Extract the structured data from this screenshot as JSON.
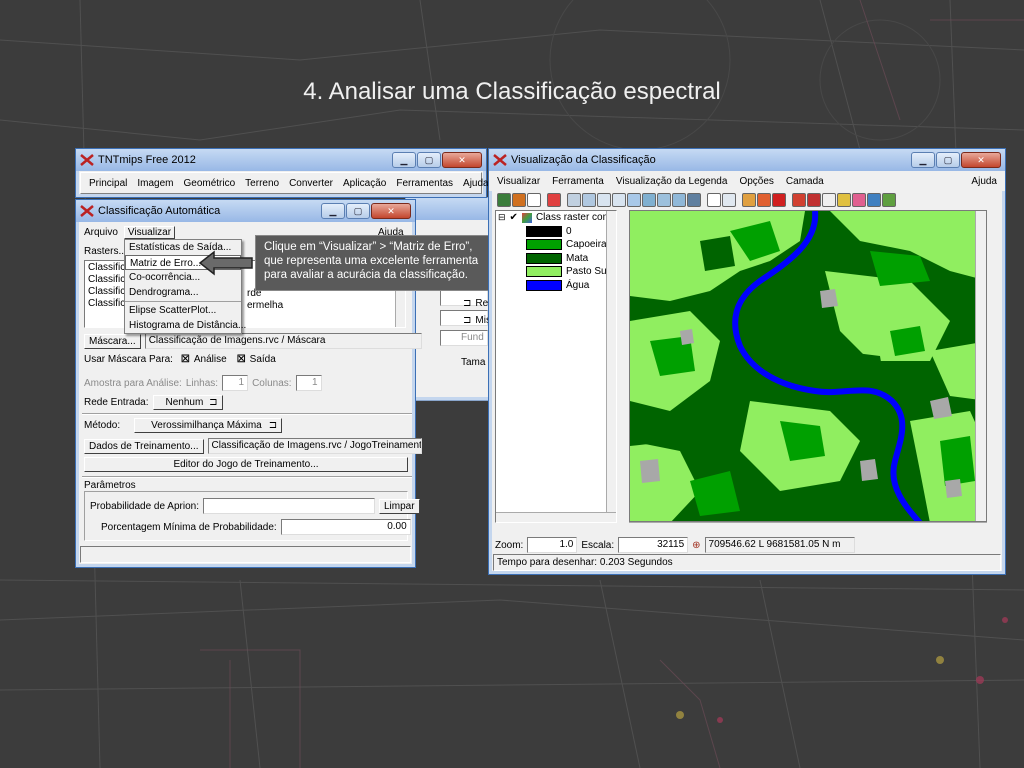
{
  "slide": {
    "title": "4. Analisar uma Classificação espectral"
  },
  "tntmips": {
    "title": "TNTmips Free 2012",
    "menu": [
      "Principal",
      "Imagem",
      "Geométrico",
      "Terreno",
      "Converter",
      "Aplicação",
      "Ferramentas",
      "Ajuda"
    ]
  },
  "classif": {
    "title": "Classificação Automática",
    "menu": [
      "Arquivo",
      "Visualizar"
    ],
    "help": "Ajuda",
    "rasters_label": "Rasters...",
    "raster_items": [
      "Classific",
      "Classific",
      "Classific",
      "Classific"
    ],
    "raster_tails": [
      "rde",
      "ermelha"
    ],
    "mask_button": "Máscara...",
    "mask_value": "Classificação de Imagens.rvc / Máscara",
    "use_mask_label": "Usar Máscara Para:",
    "use_mask_analysis": "Análise",
    "use_mask_output": "Saída",
    "sample_label": "Amostra para Análise:",
    "lines_label": "Linhas:",
    "lines_value": "1",
    "columns_label": "Colunas:",
    "columns_value": "1",
    "network_label": "Rede Entrada:",
    "network_value": "Nenhum",
    "method_label": "Método:",
    "method_value": "Verossimilhança Máxima",
    "training_button": "Dados de Treinamento...",
    "training_value": "Classificação de Imagens.rvc / JogoTreinamento",
    "editor_button": "Editor do Jogo de Treinamento...",
    "params_title": "Parâmetros",
    "prob_label": "Probabilidade de Aprion:",
    "clear_button": "Limpar",
    "min_prob_label": "Porcentagem Mínima de Probabilidade:",
    "min_prob_value": "0.00"
  },
  "visualizar_menu": {
    "items": [
      "Estatísticas de Saída...",
      "Matriz de Erro...",
      "Co-ocorrência...",
      "Dendrograma...",
      "Elipse ScatterPlot...",
      "Histograma de Distância..."
    ]
  },
  "callout": {
    "lines": [
      "Clique em “Visualizar” > “Matriz de Erro”,",
      "que representa uma excelente ferramenta",
      "para avaliar a acurácia da classificação."
    ]
  },
  "behind": {
    "labels": [
      "Re",
      "Mis",
      "Fund",
      "Tama"
    ]
  },
  "viz": {
    "title": "Visualização da Classificação",
    "menu": [
      "Visualizar",
      "Ferramenta",
      "Visualização da Legenda",
      "Opções",
      "Camada"
    ],
    "help": "Ajuda",
    "layer_name": "Class raster com",
    "legend": [
      {
        "label": "0",
        "color": "#000000"
      },
      {
        "label": "Capoeira",
        "color": "#00a000"
      },
      {
        "label": "Mata",
        "color": "#006400"
      },
      {
        "label": "Pasto Sujo",
        "color": "#90ee60"
      },
      {
        "label": "Água",
        "color": "#0000ff"
      }
    ],
    "zoom_label": "Zoom:",
    "zoom_value": "1.0",
    "scale_label": "Escala:",
    "scale_value": "32115",
    "coords": "709546.62 L  9681581.05 N m",
    "status": "Tempo para desenhar: 0.203 Segundos"
  },
  "colors": {
    "mata": "#006400",
    "capoeira": "#00a000",
    "pasto": "#90ee60",
    "agua": "#0000ff",
    "bare": "#a8a8a8"
  }
}
